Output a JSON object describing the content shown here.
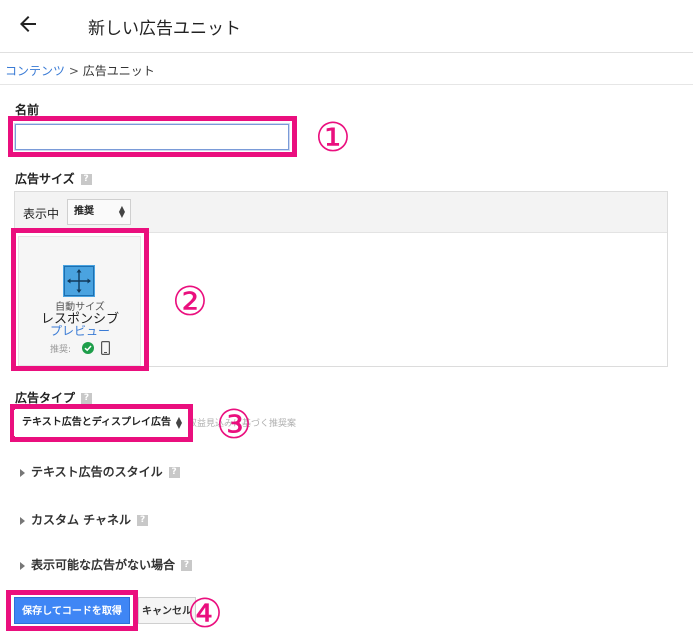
{
  "header": {
    "title": "新しい広告ユニット"
  },
  "breadcrumb": {
    "parent": "コンテンツ",
    "separator": ">",
    "current": "広告ユニット"
  },
  "form": {
    "name": {
      "label": "名前",
      "value": "",
      "placeholder": ""
    },
    "ad_size": {
      "label": "広告サイズ",
      "help": "?",
      "showing_label": "表示中",
      "filter_value": "推奨",
      "card": {
        "subtitle": "自動サイズ",
        "title": "レスポンシブ",
        "link": "プレビュー",
        "recommended_label": "推奨:"
      }
    },
    "ad_type": {
      "label": "広告タイプ",
      "help": "?",
      "selected": "テキスト広告とディスプレイ広告",
      "hint": "収益見込みに基づく推奨案"
    },
    "sections": [
      {
        "label": "テキスト広告のスタイル",
        "help": "?"
      },
      {
        "label": "カスタム チャネル",
        "help": "?"
      },
      {
        "label": "表示可能な広告がない場合",
        "help": "?"
      }
    ],
    "buttons": {
      "save": "保存してコードを取得",
      "cancel": "キャンセル"
    }
  },
  "annotations": [
    "①",
    "②",
    "③",
    "④"
  ],
  "colors": {
    "highlight": "#ea0f7e",
    "primary": "#3f86f5",
    "link": "#3a7bd5",
    "check": "#1e9e4a"
  }
}
